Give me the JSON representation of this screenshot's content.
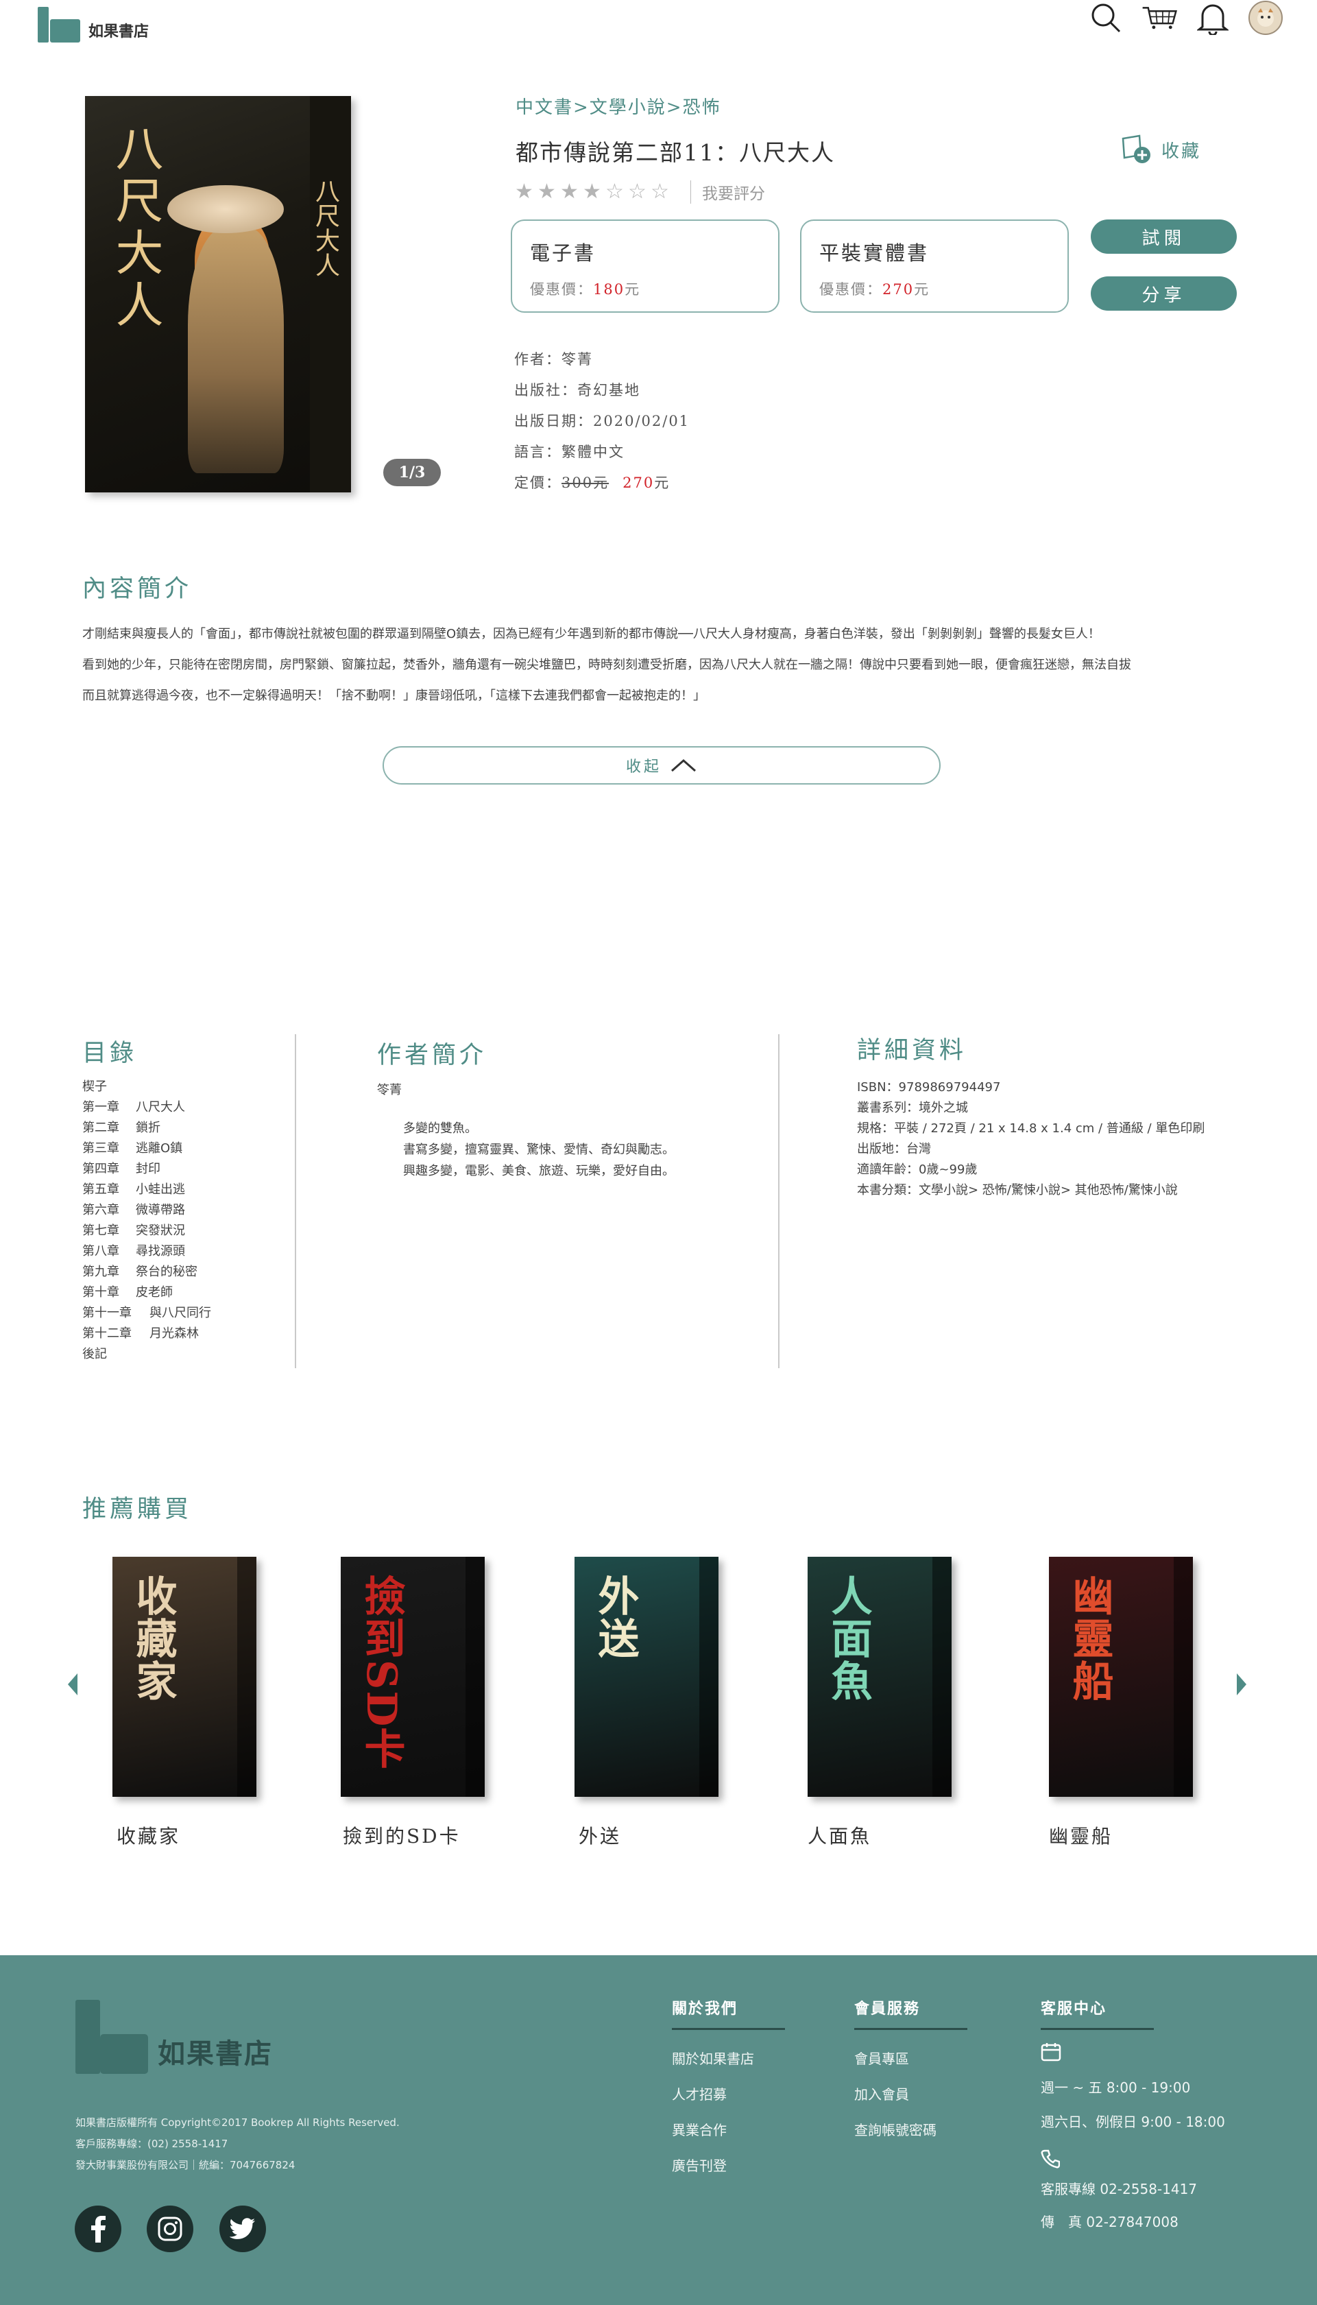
{
  "header": {
    "logo_text": "如果書店",
    "icons": [
      "search-icon",
      "cart-icon",
      "bell-icon",
      "avatar"
    ]
  },
  "book": {
    "breadcrumb": "中文書>文學小說>恐怖",
    "title": "都市傳說第二部11：八尺大人",
    "favorite_label": "收藏",
    "rating": {
      "filled": 4,
      "total": 7,
      "rate_label": "我要評分"
    },
    "cover_title": "八尺大人",
    "cover_spine": "八尺大人",
    "image_pager": "1/3",
    "ebook": {
      "title": "電子書",
      "price_label": "優惠價：",
      "price": "180",
      "unit": "元"
    },
    "print": {
      "title": "平裝實體書",
      "price_label": "優惠價：",
      "price": "270",
      "unit": "元"
    },
    "buttons": {
      "preview": "試閱",
      "share": "分享"
    },
    "meta": {
      "author": "作者：笭菁",
      "publisher": "出版社：奇幻基地",
      "date": "出版日期：2020/02/01",
      "language": "語言：繁體中文",
      "price_prefix": "定價：",
      "price_original": "300元",
      "price_sale": "270",
      "price_unit": "元"
    }
  },
  "summary": {
    "heading": "內容簡介",
    "lines": [
      "才剛結束與瘦長人的「會面」，都市傳說社就被包圍的群眾逼到隔壁O鎮去，因為已經有少年遇到新的都市傳說──八尺大人身材瘦高，身著白色洋裝，發出「剝剝剝剝」聲響的長髮女巨人！",
      "看到她的少年，只能待在密閉房間，房門緊鎖、窗簾拉起，焚香外，牆角還有一碗尖堆鹽巴，時時刻刻遭受折磨，因為八尺大人就在一牆之隔！傳說中只要看到她一眼，便會瘋狂迷戀，無法自拔",
      "而且就算逃得過今夜，也不一定躲得過明天！「捨不動啊！」康晉翊低吼，「這樣下去連我們都會一起被抱走的！」"
    ],
    "collapse_label": "收起"
  },
  "toc": {
    "heading": "目錄",
    "items": [
      {
        "ch": "楔子",
        "name": ""
      },
      {
        "ch": "第一章",
        "name": "八尺大人"
      },
      {
        "ch": "第二章",
        "name": "鎖折"
      },
      {
        "ch": "第三章",
        "name": "逃離O鎮"
      },
      {
        "ch": "第四章",
        "name": "封印"
      },
      {
        "ch": "第五章",
        "name": "小蛙出逃"
      },
      {
        "ch": "第六章",
        "name": "微導帶路"
      },
      {
        "ch": "第七章",
        "name": "突發狀況"
      },
      {
        "ch": "第八章",
        "name": "尋找源頭"
      },
      {
        "ch": "第九章",
        "name": "祭台的秘密"
      },
      {
        "ch": "第十章",
        "name": "皮老師"
      },
      {
        "ch": "第十一章",
        "name": "與八尺同行"
      },
      {
        "ch": "第十二章",
        "name": "月光森林"
      },
      {
        "ch": "後記",
        "name": ""
      }
    ]
  },
  "author": {
    "heading": "作者簡介",
    "name": "笭菁",
    "bio": [
      "多變的雙魚。",
      "書寫多變，擅寫靈異、驚悚、愛情、奇幻與勵志。",
      "興趣多變，電影、美食、旅遊、玩樂，愛好自由。"
    ]
  },
  "details": {
    "heading": "詳細資料",
    "lines": [
      "ISBN：9789869794497",
      "叢書系列：境外之城",
      "規格：平裝 / 272頁 / 21 x 14.8 x 1.4 cm / 普通級 / 單色印刷",
      "出版地：台灣",
      "適讀年齡：0歲~99歲",
      "本書分類：文學小說> 恐怖/驚悚小說> 其他恐怖/驚悚小說"
    ]
  },
  "recommend": {
    "heading": "推薦購買",
    "items": [
      {
        "name": "收藏家",
        "cover_title": "收藏家",
        "color": "#4a3b2c",
        "title_color": "#e7d2b0"
      },
      {
        "name": "撿到的SD卡",
        "cover_title": "撿到SD卡",
        "color": "#1a1a1a",
        "title_color": "#c4231f"
      },
      {
        "name": "外送",
        "cover_title": "外送",
        "color": "#1f4c4a",
        "title_color": "#f0e9c8"
      },
      {
        "name": "人面魚",
        "cover_title": "人面魚",
        "color": "#1e3b36",
        "title_color": "#7fd6b5"
      },
      {
        "name": "幽靈船",
        "cover_title": "幽靈船",
        "color": "#3a1517",
        "title_color": "#e04d2c"
      }
    ]
  },
  "footer": {
    "logo_text": "如果書店",
    "copyright": "如果書店版權所有 Copyright©2017 Bookrep All Rights Reserved.",
    "hotline": "客戶服務專線：(02) 2558-1417",
    "company": "發大財事業股份有限公司｜統編：7047667824",
    "about": {
      "heading": "關於我們",
      "links": [
        "關於如果書店",
        "人才招募",
        "異業合作",
        "廣告刊登"
      ]
    },
    "member": {
      "heading": "會員服務",
      "links": [
        "會員專區",
        "加入會員",
        "查詢帳號密碼"
      ]
    },
    "service": {
      "heading": "客服中心",
      "hours1": "週一 ~ 五 8:00 - 19:00",
      "hours2": "週六日、例假日 9:00 - 18:00",
      "phone": "客服專線 02-2558-1417",
      "fax": "傳　真 02-27847008"
    },
    "social": [
      "facebook-icon",
      "instagram-icon",
      "twitter-icon"
    ]
  },
  "colors": {
    "accent": "#4f8c86",
    "footer_bg": "#5a8e89",
    "price_red": "#d2232a"
  }
}
